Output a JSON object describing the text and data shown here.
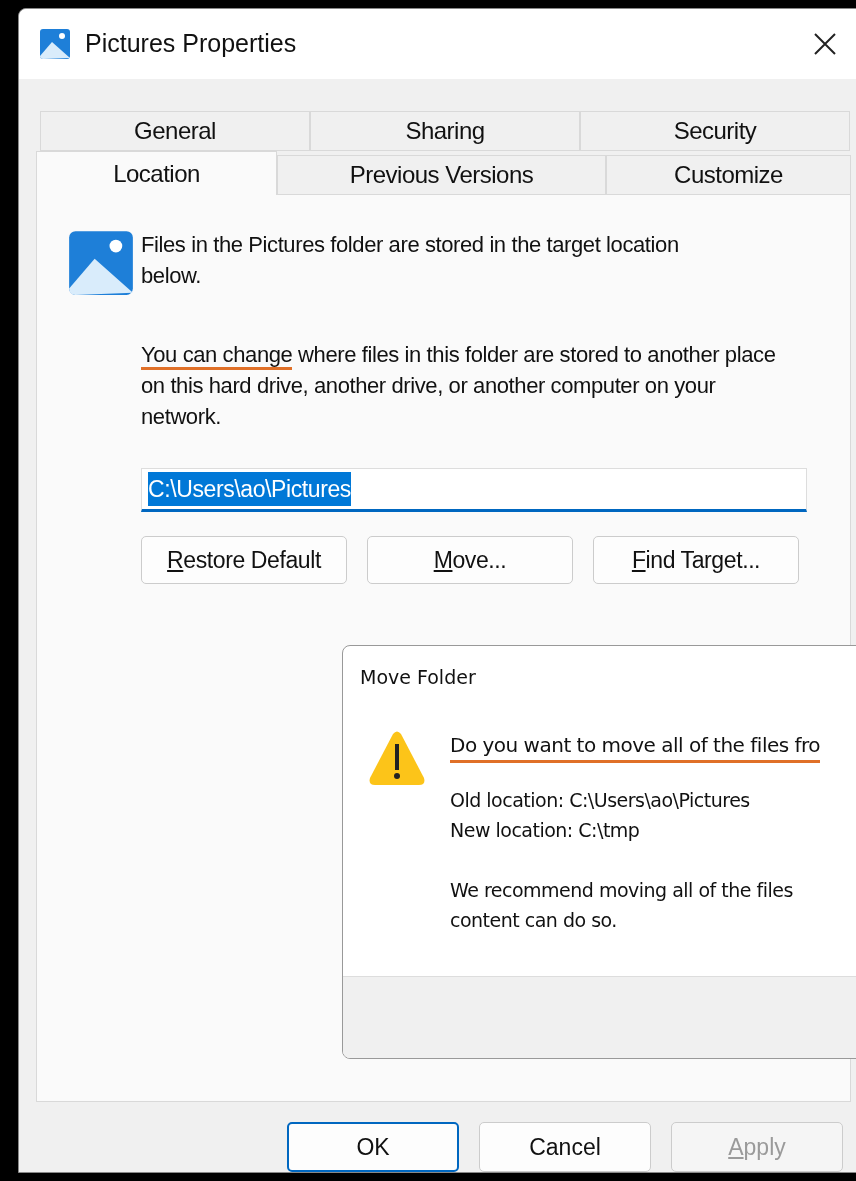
{
  "window": {
    "title": "Pictures Properties"
  },
  "tab_rows": [
    [
      {
        "label": "General",
        "selected": false
      },
      {
        "label": "Sharing",
        "selected": false
      },
      {
        "label": "Security",
        "selected": false
      }
    ],
    [
      {
        "label": "Location",
        "selected": true
      },
      {
        "label": "Previous Versions",
        "selected": false
      },
      {
        "label": "Customize",
        "selected": false
      }
    ]
  ],
  "location": {
    "intro": "Files in the Pictures folder are stored in the target location below.",
    "explanation": {
      "marked": "You can change",
      "rest": " where files in this folder are stored to another place on this hard drive, another drive, or another computer on your network."
    },
    "path": {
      "value": "C:\\Users\\ao\\Pictures",
      "selected": true
    },
    "buttons": [
      {
        "label": "Restore Default",
        "mnemonic": true
      },
      {
        "label": "Move...",
        "mnemonic": true
      },
      {
        "label": "Find Target...",
        "mnemonic": true
      }
    ]
  },
  "move_dialog": {
    "title": "Move Folder",
    "question": "Do you want to move all of the files fro",
    "question_marked": true,
    "details": [
      "Old location: C:\\Users\\ao\\Pictures",
      "New location: C:\\tmp"
    ],
    "note_lines": [
      "We recommend moving all of the files",
      "content can do so."
    ]
  },
  "footer_buttons": [
    {
      "label": "OK",
      "default": true,
      "disabled": false,
      "mnemonic": false
    },
    {
      "label": "Cancel",
      "default": false,
      "disabled": false,
      "mnemonic": false
    },
    {
      "label": "Apply",
      "default": false,
      "disabled": true,
      "mnemonic": true
    }
  ]
}
